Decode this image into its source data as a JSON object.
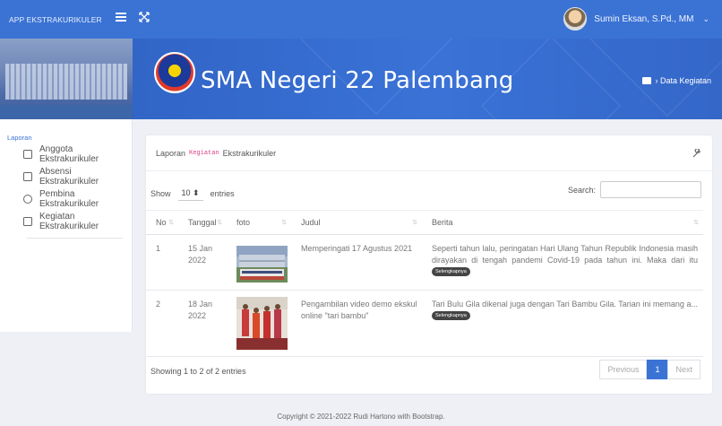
{
  "topbar": {
    "brand": "APP EKSTRAKURIKULER",
    "user_name": "Sumin Eksan, S.Pd., MM",
    "user_chevron": "⌄"
  },
  "hero": {
    "title": "SMA Negeri 22 Palembang",
    "breadcrumb": "› Data Kegiatan"
  },
  "sidebar": {
    "section": "Laporan",
    "items": [
      {
        "label": "Anggota Ekstrakurikuler",
        "icon": "users-icon"
      },
      {
        "label": "Absensi Ekstrakurikuler",
        "icon": "checklist-icon"
      },
      {
        "label": "Pembina Ekstrakurikuler",
        "icon": "user-icon"
      },
      {
        "label": "Kegiatan Ekstrakurikuler",
        "icon": "document-icon"
      }
    ]
  },
  "card": {
    "title_pre": "Laporan",
    "title_code": "Kegiatan",
    "title_post": "Ekstrakurikuler",
    "show_label": "Show",
    "entries_value": "10 ⬍",
    "entries_label": "entries",
    "search_label": "Search:",
    "search_value": ""
  },
  "table": {
    "headers": [
      "No",
      "Tanggal",
      "foto",
      "Judul",
      "Berita"
    ],
    "rows": [
      {
        "no": "1",
        "tanggal": "15 Jan 2022",
        "judul": "Memperingati 17 Agustus 2021",
        "berita": "Seperti tahun lalu, peringatan Hari Ulang Tahun Republik Indonesia masih dirayakan di tengah pandemi Covid-19 pada tahun ini. Maka dari itu",
        "more": "Selengkapnya"
      },
      {
        "no": "2",
        "tanggal": "18 Jan 2022",
        "judul": "Pengambilan video demo ekskul online \"tari bambu\"",
        "berita": "Tari Bulu Gila dikenal juga dengan Tari Bambu Gila. Tarian ini memang a...",
        "more": "Selengkapnya"
      }
    ]
  },
  "pagination": {
    "info": "Showing 1 to 2 of 2 entries",
    "previous": "Previous",
    "current": "1",
    "next": "Next"
  },
  "footer": "Copyright © 2021-2022 Rudi Hartono with Bootstrap."
}
